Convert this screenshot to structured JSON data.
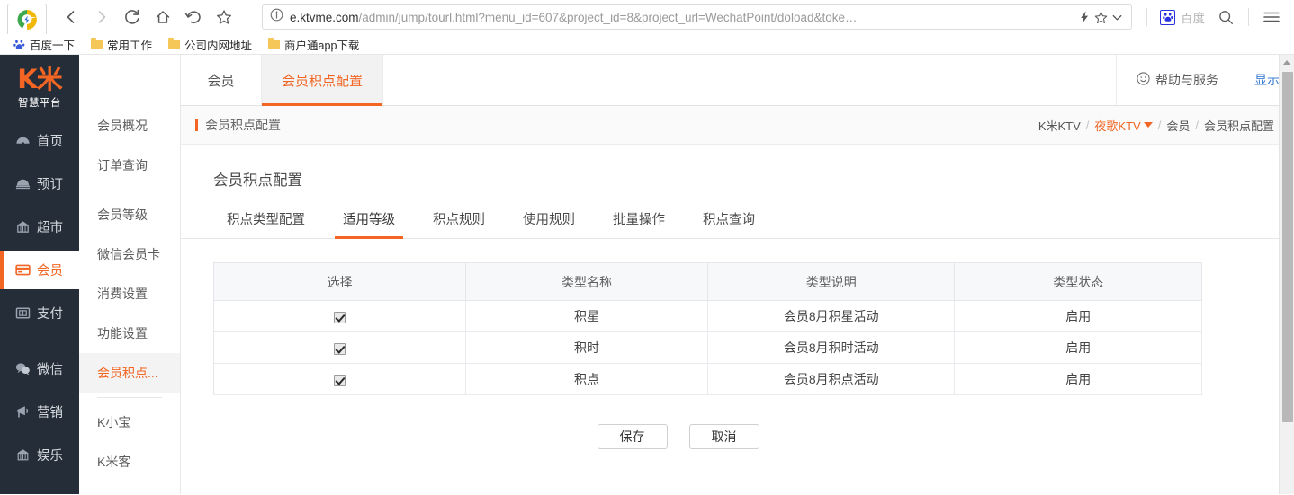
{
  "browser": {
    "url_prefix": "e.ktvme.com",
    "url_rest": "/admin/jump/tourl.html?menu_id=607&project_id=8&project_url=WechatPoint/doload&toke…",
    "back_label": "back-navigation",
    "forward_label": "forward-navigation",
    "reload_label": "reload",
    "home_label": "home",
    "history_label": "history",
    "bookmark_label": "bookmark",
    "search_engine": "百度",
    "bookmarks": [
      {
        "label": "百度一下",
        "icon": "baidu-paw-icon"
      },
      {
        "label": "常用工作",
        "icon": "folder-icon"
      },
      {
        "label": "公司内网地址",
        "icon": "folder-icon"
      },
      {
        "label": "商户通app下载",
        "icon": "folder-icon"
      }
    ]
  },
  "sidebar": {
    "brand_logo": "K米",
    "brand_sub": "智慧平台",
    "items": [
      {
        "label": "首页",
        "icon": "dashboard-icon"
      },
      {
        "label": "预订",
        "icon": "booking-icon"
      },
      {
        "label": "超市",
        "icon": "store-icon"
      },
      {
        "label": "会员",
        "icon": "membercard-icon",
        "active": true
      },
      {
        "label": "支付",
        "icon": "payment-icon"
      },
      {
        "label": "微信",
        "icon": "wechat-icon"
      },
      {
        "label": "营销",
        "icon": "marketing-icon"
      },
      {
        "label": "娱乐",
        "icon": "entertainment-icon"
      }
    ]
  },
  "submenu": {
    "items": [
      {
        "label": "会员概况"
      },
      {
        "label": "订单查询"
      },
      {
        "divider": true
      },
      {
        "label": "会员等级"
      },
      {
        "label": "微信会员卡"
      },
      {
        "label": "消费设置"
      },
      {
        "label": "功能设置"
      },
      {
        "label": "会员积点...",
        "active": true
      },
      {
        "divider": true
      },
      {
        "label": "K小宝"
      },
      {
        "label": "K米客"
      }
    ]
  },
  "tabstrip": {
    "tabs": [
      {
        "label": "会员"
      },
      {
        "label": "会员积点配置",
        "active": true
      }
    ],
    "help_label": "帮助与服务",
    "help_icon": "smiley-icon",
    "show_label": "显示"
  },
  "breadcrumb": {
    "title": "会员积点配置",
    "path": [
      {
        "label": "K米KTV",
        "type": "plain"
      },
      {
        "label": "夜歌KTV",
        "type": "org",
        "icon": "caret-down-icon"
      },
      {
        "label": "会员",
        "type": "plain"
      },
      {
        "label": "会员积点配置",
        "type": "plain"
      }
    ],
    "separator": "/"
  },
  "content": {
    "page_title": "会员积点配置",
    "subtabs": [
      {
        "label": "积点类型配置"
      },
      {
        "label": "适用等级",
        "active": true
      },
      {
        "label": "积点规则"
      },
      {
        "label": "使用规则"
      },
      {
        "label": "批量操作"
      },
      {
        "label": "积点查询"
      }
    ],
    "table": {
      "headers": [
        "选择",
        "类型名称",
        "类型说明",
        "类型状态"
      ],
      "rows": [
        {
          "checked": true,
          "name": "积星",
          "desc": "会员8月积星活动",
          "status": "启用"
        },
        {
          "checked": true,
          "name": "积时",
          "desc": "会员8月积时活动",
          "status": "启用"
        },
        {
          "checked": true,
          "name": "积点",
          "desc": "会员8月积点活动",
          "status": "启用"
        }
      ]
    },
    "buttons": {
      "save": "保存",
      "cancel": "取消"
    }
  },
  "colors": {
    "accent": "#f26522",
    "sidebar_bg": "#242d38",
    "link": "#3d7fd1"
  }
}
